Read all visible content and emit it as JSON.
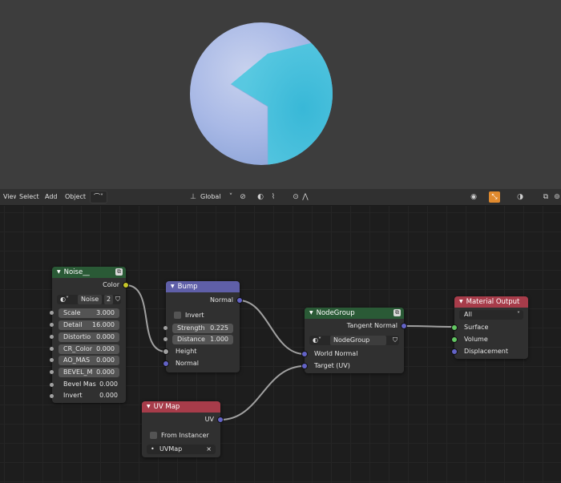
{
  "header": {
    "view": "View",
    "select": "Select",
    "add": "Add",
    "object": "Object",
    "transform": "Global"
  },
  "nodes": {
    "noise": {
      "title": "Noise__",
      "output_color": "Color",
      "group_name": "Noise",
      "users": "2",
      "fields": [
        {
          "label": "Scale",
          "value": "3.000"
        },
        {
          "label": "Detail",
          "value": "16.000"
        },
        {
          "label": "Distortio",
          "value": "0.000"
        },
        {
          "label": "CR_Color",
          "value": "0.000"
        },
        {
          "label": "AO_MAS",
          "value": "0.000"
        },
        {
          "label": "BEVEL_M",
          "value": "0.000"
        }
      ],
      "plain_inputs": [
        {
          "label": "Bevel Mas",
          "value": "0.000"
        },
        {
          "label": "Invert",
          "value": "0.000"
        }
      ]
    },
    "bump": {
      "title": "Bump",
      "output_normal": "Normal",
      "invert": "Invert",
      "strength_label": "Strength",
      "strength_value": "0.225",
      "distance_label": "Distance",
      "distance_value": "1.000",
      "input_height": "Height",
      "input_normal": "Normal"
    },
    "nodegroup": {
      "title": "NodeGroup",
      "output": "Tangent Normal",
      "group_name": "NodeGroup",
      "input_world_normal": "World Normal",
      "input_target": "Target (UV)"
    },
    "material_output": {
      "title": "Material Output",
      "target": "All",
      "input_surface": "Surface",
      "input_volume": "Volume",
      "input_displacement": "Displacement"
    },
    "uvmap": {
      "title": "UV Map",
      "output": "UV",
      "from_instancer": "From Instancer",
      "map_name": "UVMap"
    }
  },
  "colors": {
    "header_green": "#2a5a36",
    "header_purple": "#5f5fa8",
    "header_red": "#a73c4a",
    "socket_yellow": "#c7c729",
    "socket_gray": "#a1a1a1",
    "socket_blue": "#6363c7",
    "socket_green": "#63c763"
  }
}
